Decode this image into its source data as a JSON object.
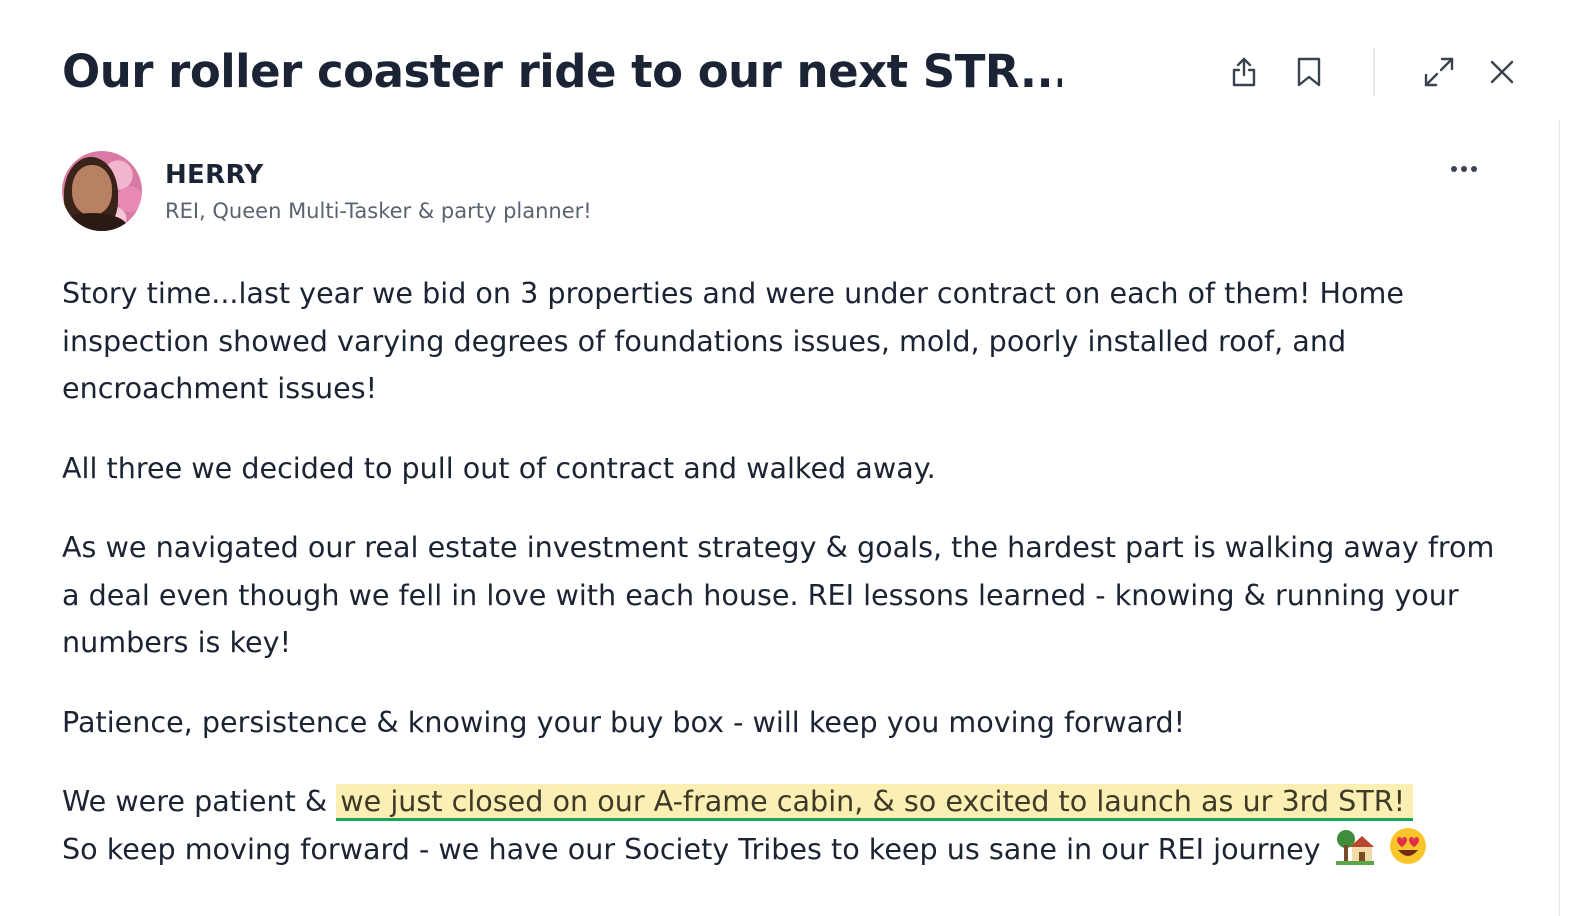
{
  "header": {
    "title": "Our roller coaster ride to our next STR...",
    "icons": {
      "share": "share-icon",
      "bookmark": "bookmark-icon",
      "expand": "expand-icon",
      "close": "close-icon"
    }
  },
  "author": {
    "name": "HERRY",
    "bio": "REI, Queen Multi-Tasker & party planner!",
    "more_icon": "more-horizontal-icon"
  },
  "post": {
    "paragraphs": [
      "Story time...last year we bid on 3 properties and were under contract on each of them! Home inspection showed varying degrees of foundations issues, mold, poorly  installed roof, and encroachment issues!",
      "All three we decided to pull out of contract and walked away.",
      "As we  navigated our real estate investment strategy & goals, the hardest part is walking away from a deal even though we fell in love with each house.  REI lessons learned - knowing & running your numbers is key!",
      "Patience, persistence & knowing your buy box  - will keep you moving forward!"
    ],
    "last": {
      "before": "We were patient & ",
      "highlight": "we just closed on our A-frame cabin, & so excited to launch as ur 3rd STR!",
      "after": "So keep moving forward - we have our Society Tribes to keep us sane in our REI journey",
      "emojis": [
        "house-with-garden-emoji",
        "heart-eyes-emoji"
      ]
    }
  },
  "colors": {
    "text": "#1c2333",
    "muted": "#5b6270",
    "highlight_bg": "#fbefb3",
    "highlight_underline": "#1aa35a"
  }
}
